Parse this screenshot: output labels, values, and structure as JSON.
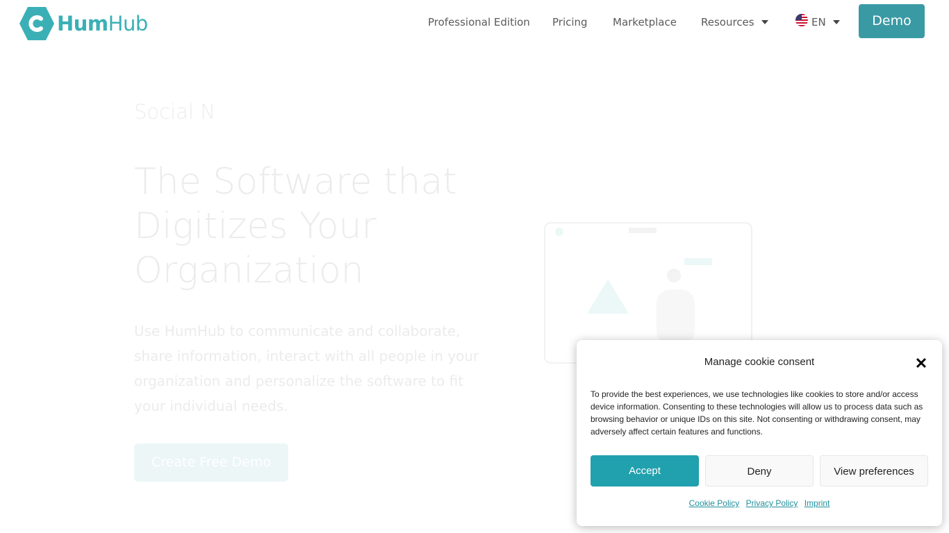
{
  "brand": {
    "name_bold": "Hum",
    "name_light": "Hub",
    "logo_color": "#3ab0b6"
  },
  "nav": {
    "items": [
      {
        "label": "Professional Edition"
      },
      {
        "label": "Pricing"
      },
      {
        "label": "Marketplace"
      },
      {
        "label": "Resources"
      }
    ],
    "language": "EN",
    "demo_label": "Demo"
  },
  "hero": {
    "eyebrow": "Social N",
    "title": "The Software that Digitizes Your Organization",
    "text": "Use HumHub to communicate and collaborate, share information, interact with all people in your organization and personalize the software to fit your individual needs.",
    "cta": "Create Free Demo"
  },
  "cookie": {
    "title": "Manage cookie consent",
    "text": "To provide the best experiences, we use technologies like cookies to store and/or access device information. Consenting to these technologies will allow us to process data such as browsing behavior or unique IDs on this site. Not consenting or withdrawing consent, may adversely affect certain features and functions.",
    "accept": "Accept",
    "deny": "Deny",
    "preferences": "View preferences",
    "links": [
      "Cookie Policy",
      "Privacy Policy",
      "Imprint"
    ],
    "accent": "#21a0ad"
  },
  "colors": {
    "demo_button": "#3a9aa4",
    "link": "#1f8f9c"
  }
}
